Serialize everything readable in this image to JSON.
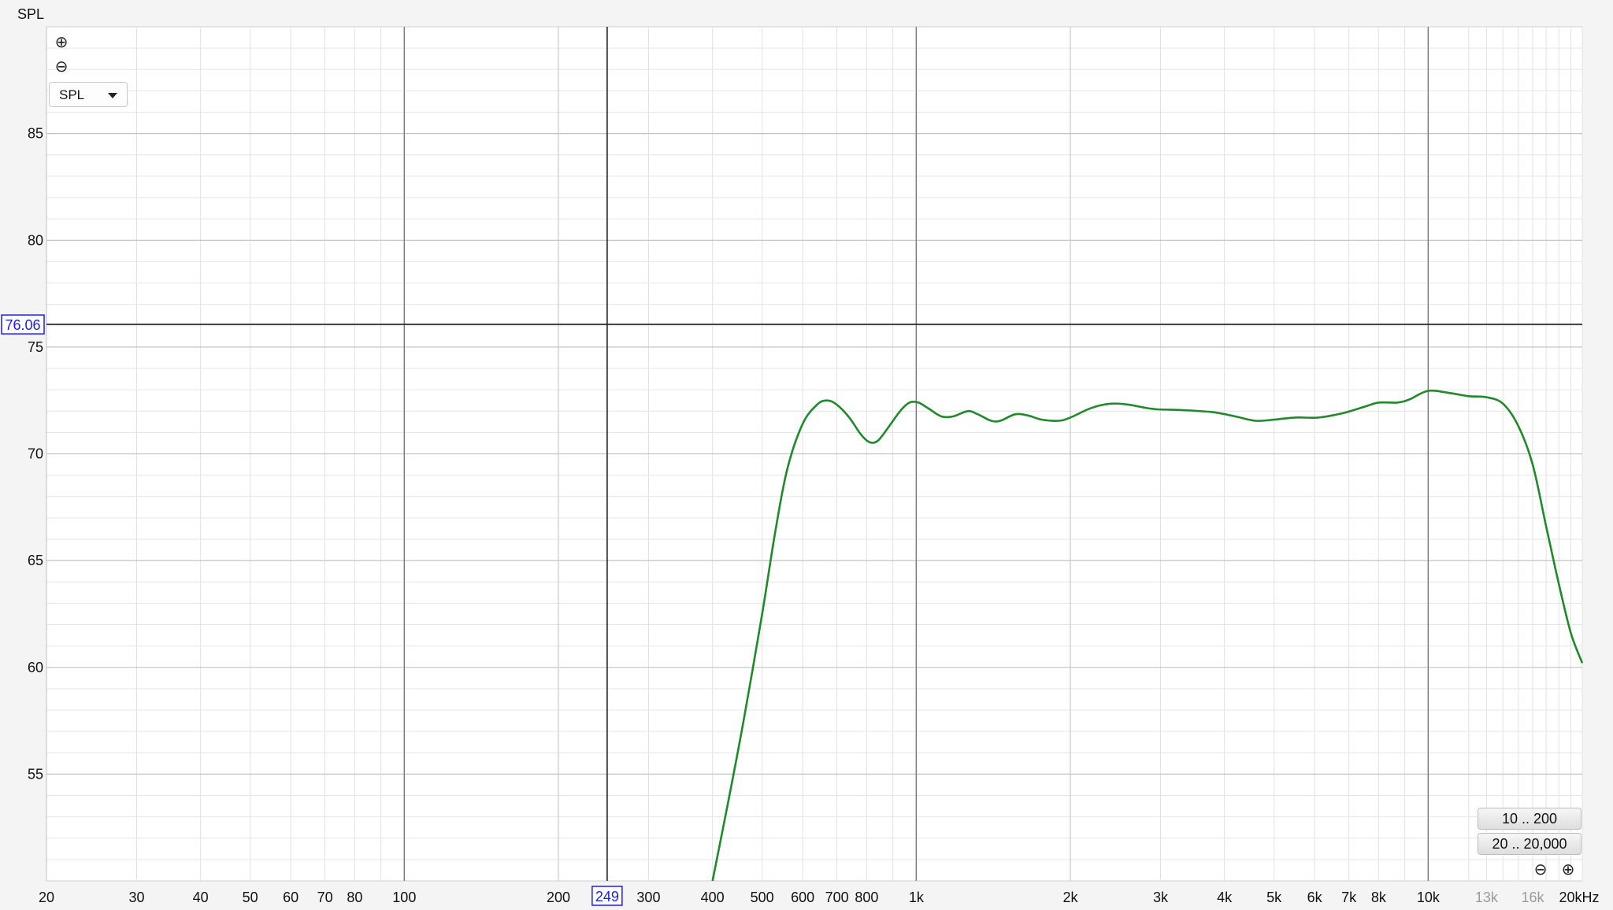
{
  "panel_label": "SPL",
  "controls": {
    "zoom_in_icon": "⊕",
    "zoom_out_icon": "⊖",
    "dropdown_value": "SPL",
    "range_buttons": [
      "10 .. 200",
      "20 .. 20,000"
    ],
    "corner_zoom_out_icon": "⊖",
    "corner_zoom_in_icon": "⊕"
  },
  "cursor": {
    "x_value": 249,
    "x_label": "249",
    "y_value": 76.06,
    "y_label": "76.06"
  },
  "colors": {
    "trace": "#1f8a2a",
    "cursor_label": "#1a1aff"
  },
  "chart_data": {
    "type": "line",
    "x_scale": "log",
    "xlim": [
      20,
      20000
    ],
    "ylim": [
      50,
      90
    ],
    "grid": true,
    "x_tick_labels": [
      {
        "value": 20,
        "label": "20"
      },
      {
        "value": 30,
        "label": "30"
      },
      {
        "value": 40,
        "label": "40"
      },
      {
        "value": 50,
        "label": "50"
      },
      {
        "value": 60,
        "label": "60"
      },
      {
        "value": 70,
        "label": "70"
      },
      {
        "value": 80,
        "label": "80"
      },
      {
        "value": 100,
        "label": "100"
      },
      {
        "value": 200,
        "label": "200"
      },
      {
        "value": 300,
        "label": "300"
      },
      {
        "value": 400,
        "label": "400"
      },
      {
        "value": 500,
        "label": "500"
      },
      {
        "value": 600,
        "label": "600"
      },
      {
        "value": 700,
        "label": "700"
      },
      {
        "value": 800,
        "label": "800"
      },
      {
        "value": 1000,
        "label": "1k"
      },
      {
        "value": 2000,
        "label": "2k"
      },
      {
        "value": 3000,
        "label": "3k"
      },
      {
        "value": 4000,
        "label": "4k"
      },
      {
        "value": 5000,
        "label": "5k"
      },
      {
        "value": 6000,
        "label": "6k"
      },
      {
        "value": 7000,
        "label": "7k"
      },
      {
        "value": 8000,
        "label": "8k"
      },
      {
        "value": 10000,
        "label": "10k"
      },
      {
        "value": 13000,
        "label": "13k",
        "muted": true
      },
      {
        "value": 16000,
        "label": "16k",
        "muted": true
      },
      {
        "value": 20000,
        "label": "20kHz"
      }
    ],
    "y_tick_labels": [
      {
        "value": 55,
        "label": "55"
      },
      {
        "value": 60,
        "label": "60"
      },
      {
        "value": 65,
        "label": "65"
      },
      {
        "value": 70,
        "label": "70"
      },
      {
        "value": 75,
        "label": "75"
      },
      {
        "value": 80,
        "label": "80"
      },
      {
        "value": 85,
        "label": "85"
      }
    ],
    "series": [
      {
        "points": [
          [
            400,
            50.0
          ],
          [
            430,
            53.8
          ],
          [
            460,
            57.5
          ],
          [
            500,
            62.5
          ],
          [
            530,
            66.3
          ],
          [
            560,
            69.3
          ],
          [
            600,
            71.4
          ],
          [
            640,
            72.3
          ],
          [
            670,
            72.5
          ],
          [
            700,
            72.3
          ],
          [
            740,
            71.7
          ],
          [
            780,
            70.9
          ],
          [
            810,
            70.55
          ],
          [
            840,
            70.6
          ],
          [
            880,
            71.2
          ],
          [
            930,
            72.0
          ],
          [
            970,
            72.4
          ],
          [
            1010,
            72.4
          ],
          [
            1060,
            72.1
          ],
          [
            1120,
            71.75
          ],
          [
            1180,
            71.75
          ],
          [
            1260,
            72.0
          ],
          [
            1320,
            71.85
          ],
          [
            1400,
            71.55
          ],
          [
            1460,
            71.55
          ],
          [
            1560,
            71.85
          ],
          [
            1650,
            71.8
          ],
          [
            1760,
            71.6
          ],
          [
            1900,
            71.55
          ],
          [
            2000,
            71.7
          ],
          [
            2200,
            72.15
          ],
          [
            2400,
            72.35
          ],
          [
            2600,
            72.3
          ],
          [
            2900,
            72.1
          ],
          [
            3300,
            72.05
          ],
          [
            3800,
            71.95
          ],
          [
            4200,
            71.75
          ],
          [
            4600,
            71.55
          ],
          [
            5000,
            71.6
          ],
          [
            5500,
            71.7
          ],
          [
            6100,
            71.7
          ],
          [
            6800,
            71.9
          ],
          [
            7500,
            72.2
          ],
          [
            8000,
            72.4
          ],
          [
            8700,
            72.4
          ],
          [
            9200,
            72.55
          ],
          [
            10000,
            72.95
          ],
          [
            11000,
            72.85
          ],
          [
            12000,
            72.7
          ],
          [
            13000,
            72.65
          ],
          [
            14000,
            72.35
          ],
          [
            15000,
            71.3
          ],
          [
            16000,
            69.5
          ],
          [
            17000,
            66.6
          ],
          [
            18000,
            63.9
          ],
          [
            19000,
            61.6
          ],
          [
            20000,
            60.2
          ]
        ]
      }
    ]
  }
}
